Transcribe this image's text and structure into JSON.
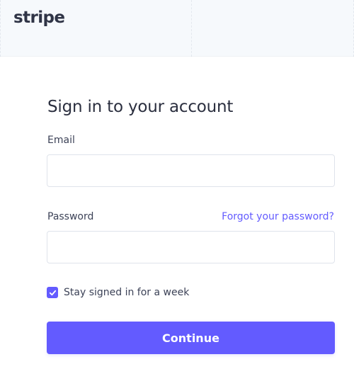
{
  "brand": {
    "logo_text": "stripe"
  },
  "form": {
    "title": "Sign in to your account",
    "email": {
      "label": "Email",
      "value": "",
      "placeholder": ""
    },
    "password": {
      "label": "Password",
      "value": "",
      "placeholder": "",
      "forgot_link": "Forgot your password?"
    },
    "stay_signed_in": {
      "label": "Stay signed in for a week",
      "checked": true
    },
    "submit_label": "Continue"
  },
  "colors": {
    "accent": "#635bff",
    "header_bg": "#f6f9fc",
    "text_dark": "#2b2f3f",
    "text_label": "#3c4257",
    "field_border": "#dfe3eb"
  },
  "icons": {
    "checkbox": "check-icon"
  }
}
